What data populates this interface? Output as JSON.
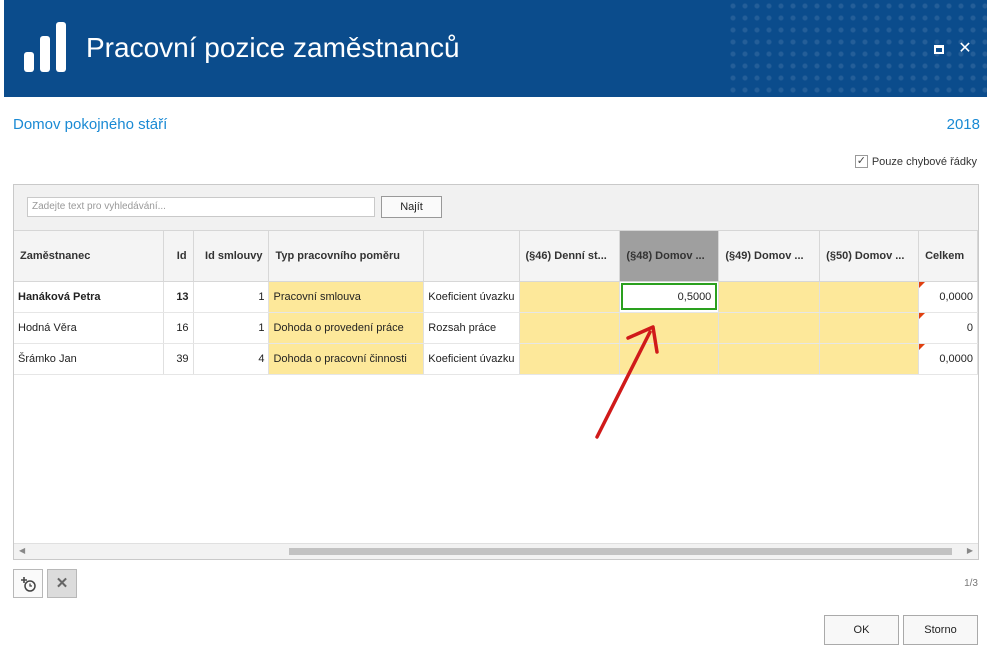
{
  "window": {
    "title": "Pracovní pozice zaměstnanců"
  },
  "header": {
    "organization": "Domov pokojného stáří",
    "year": "2018"
  },
  "filter": {
    "only_errors_label": "Pouze chybové řádky",
    "checked": true
  },
  "search": {
    "placeholder": "Zadejte text pro vyhledávání...",
    "find_label": "Najít"
  },
  "table": {
    "columns": [
      "Zaměstnanec",
      "Id",
      "Id smlouvy",
      "Typ pracovního poměru",
      "",
      "(§46) Denní st...",
      "(§48) Domov ...",
      "(§49) Domov ...",
      "(§50) Domov ...",
      "Celkem"
    ],
    "rows": [
      {
        "name": "Hanáková Petra",
        "id": "13",
        "contract_id": "1",
        "type": "Pracovní smlouva",
        "unit": "Koeficient úvazku",
        "c46": "",
        "c48": "0,5000",
        "c49": "",
        "c50": "",
        "total": "0,0000"
      },
      {
        "name": "Hodná Věra",
        "id": "16",
        "contract_id": "1",
        "type": "Dohoda o provedení práce",
        "unit": "Rozsah práce",
        "c46": "",
        "c48": "",
        "c49": "",
        "c50": "",
        "total": "0"
      },
      {
        "name": "Šrámko Jan",
        "id": "39",
        "contract_id": "4",
        "type": "Dohoda o pracovní činnosti",
        "unit": "Koeficient úvazku",
        "c46": "",
        "c48": "",
        "c49": "",
        "c50": "",
        "total": "0,0000"
      }
    ]
  },
  "pager": {
    "text": "1/3"
  },
  "buttons": {
    "ok": "OK",
    "cancel": "Storno"
  },
  "icons": {
    "logo": "bar-chart-logo-icon",
    "add": "add-clock-icon",
    "delete": "close-icon"
  },
  "colors": {
    "title_bar": "#0b4c8c",
    "accent_text": "#1a8ad4",
    "editable_cell": "#fde89a",
    "selected_border": "#2aa01e",
    "arrow": "#d01a1a"
  }
}
